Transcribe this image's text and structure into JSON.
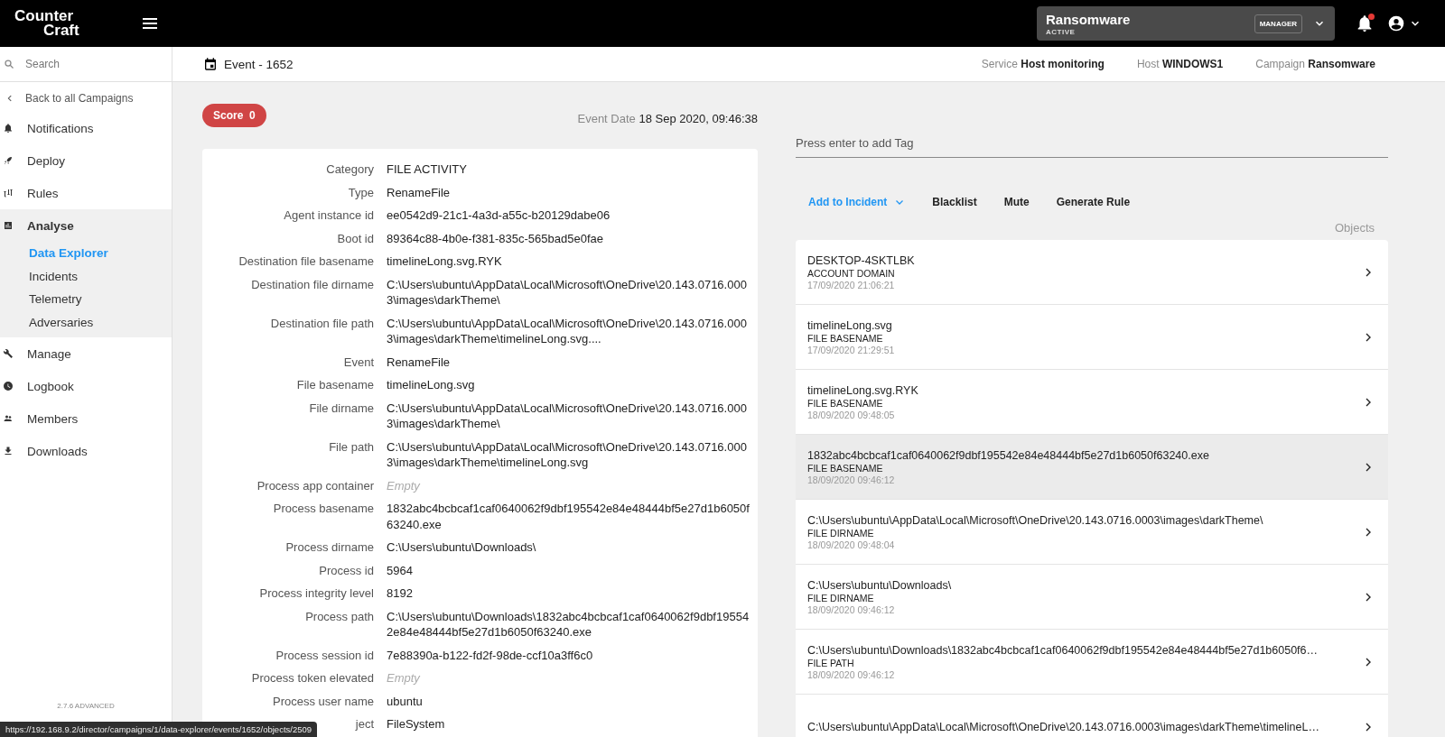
{
  "topbar": {
    "logo": [
      "Counter",
      "Craft"
    ],
    "campaign": {
      "name": "Ransomware",
      "status": "ACTIVE",
      "role": "MANAGER"
    },
    "notifications": {
      "unread": true
    }
  },
  "sidebar": {
    "search": {
      "placeholder": "Search"
    },
    "back": "Back to all Campaigns",
    "items": [
      {
        "label": "Notifications",
        "expanded": false
      },
      {
        "label": "Deploy",
        "expanded": false
      },
      {
        "label": "Rules",
        "expanded": false
      },
      {
        "label": "Analyse",
        "expanded": true,
        "children": [
          {
            "label": "Data Explorer",
            "selected": true
          },
          {
            "label": "Incidents",
            "selected": false
          },
          {
            "label": "Telemetry",
            "selected": false
          },
          {
            "label": "Adversaries",
            "selected": false
          }
        ]
      },
      {
        "label": "Manage",
        "expanded": false
      },
      {
        "label": "Logbook",
        "expanded": false
      },
      {
        "label": "Members",
        "expanded": false
      },
      {
        "label": "Downloads",
        "expanded": false
      }
    ],
    "version": "2.7.6 ADVANCED"
  },
  "header": {
    "title": "Event - 1652",
    "meta": [
      {
        "label": "Service",
        "value": "Host monitoring"
      },
      {
        "label": "Host",
        "value": "WINDOWS1"
      },
      {
        "label": "Campaign",
        "value": "Ransomware"
      }
    ]
  },
  "event": {
    "score_label": "Score",
    "score": "0",
    "date_label": "Event Date",
    "date": "18 Sep 2020, 09:46:38",
    "fields": [
      {
        "label": "Category",
        "value": "FILE ACTIVITY",
        "kind": "text"
      },
      {
        "label": "Type",
        "value": "RenameFile",
        "kind": "text"
      },
      {
        "label": "Agent instance id",
        "value": "ee0542d9-21c1-4a3d-a55c-b20129dabe06",
        "kind": "text"
      },
      {
        "label": "Boot id",
        "value": "89364c88-4b0e-f381-835c-565bad5e0fae",
        "kind": "text"
      },
      {
        "label": "Destination file basename",
        "value": "timelineLong.svg.RYK",
        "kind": "text"
      },
      {
        "label": "Destination file dirname",
        "value": "C:\\Users\\ubuntu\\AppData\\Local\\Microsoft\\OneDrive\\20.143.0716.0003\\images\\darkTheme\\",
        "kind": "text"
      },
      {
        "label": "Destination file path",
        "value": "C:\\Users\\ubuntu\\AppData\\Local\\Microsoft\\OneDrive\\20.143.0716.0003\\images\\darkTheme\\timelineLong.svg....",
        "kind": "text"
      },
      {
        "label": "Event",
        "value": "RenameFile",
        "kind": "text"
      },
      {
        "label": "File basename",
        "value": "timelineLong.svg",
        "kind": "text"
      },
      {
        "label": "File dirname",
        "value": "C:\\Users\\ubuntu\\AppData\\Local\\Microsoft\\OneDrive\\20.143.0716.0003\\images\\darkTheme\\",
        "kind": "text"
      },
      {
        "label": "File path",
        "value": "C:\\Users\\ubuntu\\AppData\\Local\\Microsoft\\OneDrive\\20.143.0716.0003\\images\\darkTheme\\timelineLong.svg",
        "kind": "text"
      },
      {
        "label": "Process app container",
        "value": "Empty",
        "kind": "empty"
      },
      {
        "label": "Process basename",
        "value": "1832abc4bcbcaf1caf0640062f9dbf195542e84e48444bf5e27d1b6050f63240.exe",
        "kind": "text"
      },
      {
        "label": "Process dirname",
        "value": "C:\\Users\\ubuntu\\Downloads\\",
        "kind": "text"
      },
      {
        "label": "Process id",
        "value": "5964",
        "kind": "text"
      },
      {
        "label": "Process integrity level",
        "value": "8192",
        "kind": "text"
      },
      {
        "label": "Process path",
        "value": "C:\\Users\\ubuntu\\Downloads\\1832abc4bcbcaf1caf0640062f9dbf195542e84e48444bf5e27d1b6050f63240.exe",
        "kind": "text"
      },
      {
        "label": "Process session id",
        "value": "7e88390a-b122-fd2f-98de-ccf10a3ff6c0",
        "kind": "text"
      },
      {
        "label": "Process token elevated",
        "value": "Empty",
        "kind": "empty"
      },
      {
        "label": "Process user name",
        "value": "ubuntu",
        "kind": "text"
      },
      {
        "label": "ject",
        "value": "FileSystem",
        "kind": "text"
      }
    ]
  },
  "tags": {
    "placeholder": "Press enter to add Tag"
  },
  "actions": [
    {
      "label": "Add to Incident",
      "kind": "dropdown"
    },
    {
      "label": "Blacklist",
      "kind": "plain"
    },
    {
      "label": "Mute",
      "kind": "plain"
    },
    {
      "label": "Generate Rule",
      "kind": "plain"
    }
  ],
  "objects": {
    "title": "Objects",
    "items": [
      {
        "name": "DESKTOP-4SKTLBK",
        "type": "ACCOUNT DOMAIN",
        "date": "17/09/2020 21:06:21",
        "selected": false
      },
      {
        "name": "timelineLong.svg",
        "type": "FILE BASENAME",
        "date": "17/09/2020 21:29:51",
        "selected": false
      },
      {
        "name": "timelineLong.svg.RYK",
        "type": "FILE BASENAME",
        "date": "18/09/2020 09:48:05",
        "selected": false
      },
      {
        "name": "1832abc4bcbcaf1caf0640062f9dbf195542e84e48444bf5e27d1b6050f63240.exe",
        "type": "FILE BASENAME",
        "date": "18/09/2020 09:46:12",
        "selected": true
      },
      {
        "name": "C:\\Users\\ubuntu\\AppData\\Local\\Microsoft\\OneDrive\\20.143.0716.0003\\images\\darkTheme\\",
        "type": "FILE DIRNAME",
        "date": "18/09/2020 09:48:04",
        "selected": false
      },
      {
        "name": "C:\\Users\\ubuntu\\Downloads\\",
        "type": "FILE DIRNAME",
        "date": "18/09/2020 09:46:12",
        "selected": false
      },
      {
        "name": "C:\\Users\\ubuntu\\Downloads\\1832abc4bcbcaf1caf0640062f9dbf195542e84e48444bf5e27d1b6050f6…",
        "type": "FILE PATH",
        "date": "18/09/2020 09:46:12",
        "selected": false
      },
      {
        "name": "C:\\Users\\ubuntu\\AppData\\Local\\Microsoft\\OneDrive\\20.143.0716.0003\\images\\darkTheme\\timelineL…",
        "selected": false
      }
    ]
  },
  "status_url": "https://192.168.9.2/director/campaigns/1/data-explorer/events/1652/objects/2509"
}
